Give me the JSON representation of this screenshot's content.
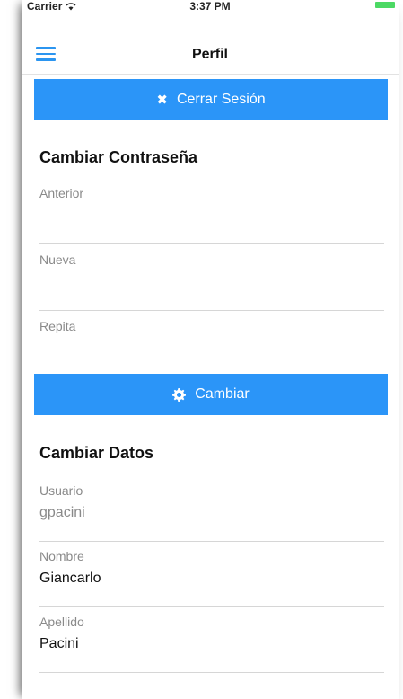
{
  "status_bar": {
    "carrier": "Carrier",
    "time": "3:37 PM"
  },
  "nav": {
    "title": "Perfil",
    "menu_icon": "hamburger-menu-icon"
  },
  "logout_button": {
    "label": "Cerrar Sesión",
    "icon": "close-icon"
  },
  "password_section": {
    "title": "Cambiar Contraseña",
    "fields": [
      {
        "label": "Anterior",
        "value": ""
      },
      {
        "label": "Nueva",
        "value": ""
      },
      {
        "label": "Repita",
        "value": ""
      }
    ],
    "change_button": {
      "label": "Cambiar",
      "icon": "gear-icon"
    }
  },
  "data_section": {
    "title": "Cambiar Datos",
    "fields": [
      {
        "label": "Usuario",
        "value": "gpacini"
      },
      {
        "label": "Nombre",
        "value": "Giancarlo"
      },
      {
        "label": "Apellido",
        "value": "Pacini"
      }
    ]
  },
  "colors": {
    "accent": "#2b95f8",
    "label": "#8a8a8a",
    "battery": "#4cd964"
  }
}
